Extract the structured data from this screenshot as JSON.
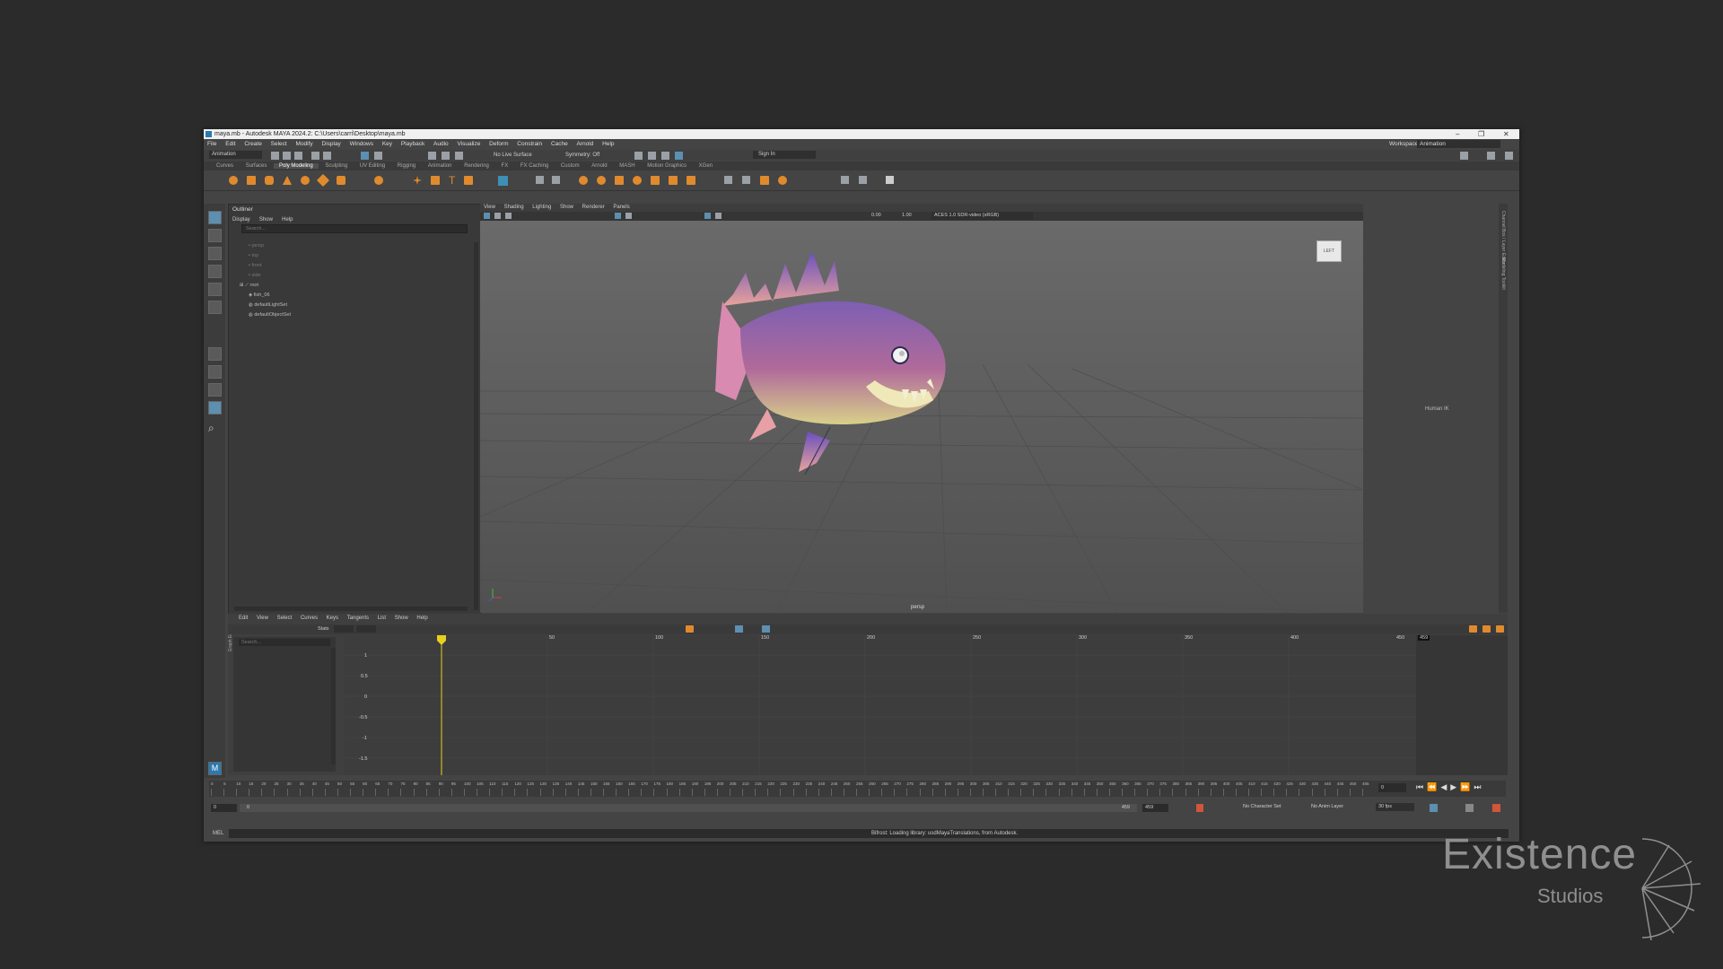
{
  "window": {
    "title": "maya.mb - Autodesk MAYA 2024.2: C:\\Users\\carri\\Desktop\\maya.mb",
    "controls": [
      "–",
      "❐",
      "✕"
    ]
  },
  "menubar": [
    "File",
    "Edit",
    "Create",
    "Select",
    "Modify",
    "Display",
    "Windows",
    "Key",
    "Playback",
    "Audio",
    "Visualize",
    "Deform",
    "Constrain",
    "Cache",
    "Arnold",
    "Help"
  ],
  "workspace": {
    "label": "Workspace:",
    "value": "Animation"
  },
  "statusline": {
    "mode": "Animation",
    "live_surface": "No Live Surface",
    "symmetry": "Symmetry: Off",
    "sign_in": "Sign In"
  },
  "shelf_tabs": [
    "Curves",
    "Surfaces",
    "Poly Modeling",
    "Sculpting",
    "UV Editing",
    "Rigging",
    "Animation",
    "Rendering",
    "FX",
    "FX Caching",
    "Custom",
    "Arnold",
    "MASH",
    "Motion Graphics",
    "XGen"
  ],
  "shelf_active": "Poly Modeling",
  "outliner": {
    "title": "Outliner",
    "menu": [
      "Display",
      "Show",
      "Help"
    ],
    "search_placeholder": "Search...",
    "items": [
      {
        "label": "persp",
        "dim": true
      },
      {
        "label": "top",
        "dim": true
      },
      {
        "label": "front",
        "dim": true
      },
      {
        "label": "side",
        "dim": true
      },
      {
        "label": "root",
        "dim": false
      },
      {
        "label": "fish_06",
        "dim": false
      },
      {
        "label": "defaultLightSet",
        "dim": false
      },
      {
        "label": "defaultObjectSet",
        "dim": false
      }
    ]
  },
  "viewport": {
    "menu": [
      "View",
      "Shading",
      "Lighting",
      "Show",
      "Renderer",
      "Panels"
    ],
    "exposure": "0.00",
    "gamma": "1.00",
    "color_space": "ACES 1.0 SDR-video (sRGB)",
    "camera_label": "persp",
    "viewcube_label": "LEFT"
  },
  "humanik": {
    "label": "Human IK"
  },
  "side_tabs": [
    "Channel Box / Layer Editor",
    "Modeling Toolkit",
    "Attribute Editor"
  ],
  "graph_editor": {
    "menu": [
      "Edit",
      "View",
      "Select",
      "Curves",
      "Keys",
      "Tangents",
      "List",
      "Show",
      "Help"
    ],
    "stats_label": "Stats",
    "search_placeholder": "Search...",
    "y_ticks": [
      "1",
      "0.5",
      "0",
      "-0.5",
      "-1",
      "-1.5"
    ],
    "x_ticks": [
      "50",
      "100",
      "150",
      "200",
      "250",
      "300",
      "350",
      "400",
      "450"
    ],
    "end_frame": "459",
    "side_label": "Graph Editor"
  },
  "timeline": {
    "ticks": [
      "0",
      "5",
      "10",
      "15",
      "20",
      "25",
      "30",
      "35",
      "40",
      "45",
      "50",
      "55",
      "60",
      "65",
      "70",
      "75",
      "80",
      "85",
      "90",
      "95",
      "100",
      "105",
      "110",
      "115",
      "120",
      "125",
      "130",
      "135",
      "140",
      "145",
      "150",
      "155",
      "160",
      "165",
      "170",
      "175",
      "180",
      "185",
      "190",
      "195",
      "200",
      "205",
      "210",
      "215",
      "220",
      "225",
      "230",
      "235",
      "240",
      "245",
      "250",
      "255",
      "260",
      "265",
      "270",
      "275",
      "280",
      "285",
      "290",
      "295",
      "300",
      "305",
      "310",
      "315",
      "320",
      "325",
      "330",
      "335",
      "340",
      "345",
      "350",
      "355",
      "360",
      "365",
      "370",
      "375",
      "380",
      "385",
      "390",
      "395",
      "400",
      "405",
      "410",
      "415",
      "420",
      "425",
      "430",
      "435",
      "440",
      "445",
      "450",
      "455"
    ],
    "current_frame": "0"
  },
  "range": {
    "start": "0",
    "range_start": "0",
    "range_end": "459",
    "end": "459",
    "character_set": "No Character Set",
    "anim_layer": "No Anim Layer",
    "fps": "30 fps"
  },
  "command_line": {
    "label": "MEL",
    "message": "Bifrost: Loading library: usdMayaTranslations, from Autodesk."
  },
  "watermark": {
    "line1": "Existence",
    "line2": "Studios"
  },
  "colors": {
    "accent": "#e08a2e",
    "background": "#2b2b2b",
    "panel": "#444444",
    "viewport": "#5f5f5f",
    "playhead": "#e6d020"
  }
}
